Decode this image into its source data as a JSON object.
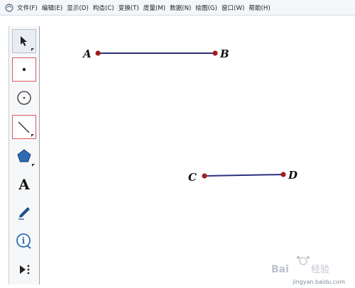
{
  "menu": {
    "items": [
      "文件(F)",
      "编辑(E)",
      "显示(D)",
      "构造(C)",
      "变换(T)",
      "度量(M)",
      "数据(N)",
      "绘图(G)",
      "窗口(W)",
      "帮助(H)"
    ]
  },
  "toolbar": {
    "tools": [
      {
        "name": "arrow-select-tool",
        "icon": "arrow-icon"
      },
      {
        "name": "point-tool",
        "icon": "point-icon"
      },
      {
        "name": "compass-tool",
        "icon": "circle-icon"
      },
      {
        "name": "straightedge-tool",
        "icon": "segment-icon"
      },
      {
        "name": "polygon-tool",
        "icon": "pentagon-icon"
      },
      {
        "name": "text-tool",
        "icon": "letter-a-icon",
        "label": "A"
      },
      {
        "name": "marker-tool",
        "icon": "pen-icon"
      },
      {
        "name": "information-tool",
        "icon": "info-icon",
        "label": "i"
      },
      {
        "name": "custom-tool",
        "icon": "play-more-icon"
      }
    ]
  },
  "sketch": {
    "segments": [
      {
        "p1": "A",
        "p2": "B"
      },
      {
        "p1": "C",
        "p2": "D"
      }
    ],
    "colors": {
      "segment": "#2c2f7c",
      "point": "#a11d1d"
    }
  },
  "watermark": {
    "text": "Bai 经验",
    "url": "jingyan.baidu.com"
  }
}
